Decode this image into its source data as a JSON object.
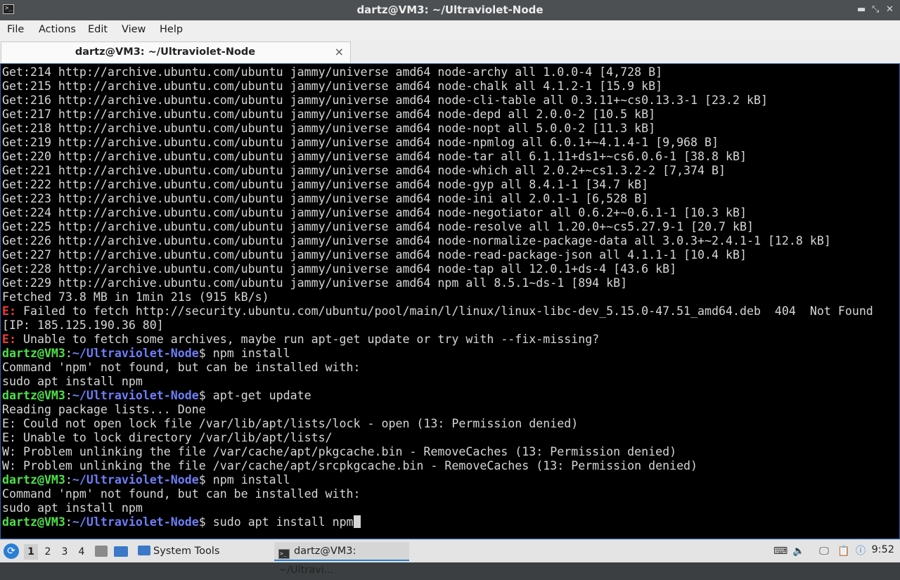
{
  "window": {
    "title": "dartz@VM3: ~/Ultraviolet-Node",
    "controls": {
      "minimize": "▬",
      "maximize": "⤡",
      "close": "✕"
    }
  },
  "menubar": {
    "items": [
      "File",
      "Actions",
      "Edit",
      "View",
      "Help"
    ]
  },
  "tabs": [
    {
      "label": "dartz@VM3: ~/Ultraviolet-Node",
      "close_glyph": "×"
    }
  ],
  "terminal": {
    "colors": {
      "background": "#000000",
      "text": "#d6d6d6",
      "error": "#ef3a3a",
      "user": "#4fe04a",
      "path": "#6e7ef8"
    },
    "prompt": {
      "user": "dartz@VM3",
      "sep": ":",
      "path": "~/Ultraviolet-Node",
      "symbol": "$"
    },
    "lines": [
      {
        "kind": "text",
        "text": "Get:214 http://archive.ubuntu.com/ubuntu jammy/universe amd64 node-archy all 1.0.0-4 [4,728 B]"
      },
      {
        "kind": "text",
        "text": "Get:215 http://archive.ubuntu.com/ubuntu jammy/universe amd64 node-chalk all 4.1.2-1 [15.9 kB]"
      },
      {
        "kind": "text",
        "text": "Get:216 http://archive.ubuntu.com/ubuntu jammy/universe amd64 node-cli-table all 0.3.11+~cs0.13.3-1 [23.2 kB]"
      },
      {
        "kind": "text",
        "text": "Get:217 http://archive.ubuntu.com/ubuntu jammy/universe amd64 node-depd all 2.0.0-2 [10.5 kB]"
      },
      {
        "kind": "text",
        "text": "Get:218 http://archive.ubuntu.com/ubuntu jammy/universe amd64 node-nopt all 5.0.0-2 [11.3 kB]"
      },
      {
        "kind": "text",
        "text": "Get:219 http://archive.ubuntu.com/ubuntu jammy/universe amd64 node-npmlog all 6.0.1+~4.1.4-1 [9,968 B]"
      },
      {
        "kind": "text",
        "text": "Get:220 http://archive.ubuntu.com/ubuntu jammy/universe amd64 node-tar all 6.1.11+ds1+~cs6.0.6-1 [38.8 kB]"
      },
      {
        "kind": "text",
        "text": "Get:221 http://archive.ubuntu.com/ubuntu jammy/universe amd64 node-which all 2.0.2+~cs1.3.2-2 [7,374 B]"
      },
      {
        "kind": "text",
        "text": "Get:222 http://archive.ubuntu.com/ubuntu jammy/universe amd64 node-gyp all 8.4.1-1 [34.7 kB]"
      },
      {
        "kind": "text",
        "text": "Get:223 http://archive.ubuntu.com/ubuntu jammy/universe amd64 node-ini all 2.0.1-1 [6,528 B]"
      },
      {
        "kind": "text",
        "text": "Get:224 http://archive.ubuntu.com/ubuntu jammy/universe amd64 node-negotiator all 0.6.2+~0.6.1-1 [10.3 kB]"
      },
      {
        "kind": "text",
        "text": "Get:225 http://archive.ubuntu.com/ubuntu jammy/universe amd64 node-resolve all 1.20.0+~cs5.27.9-1 [20.7 kB]"
      },
      {
        "kind": "text",
        "text": "Get:226 http://archive.ubuntu.com/ubuntu jammy/universe amd64 node-normalize-package-data all 3.0.3+~2.4.1-1 [12.8 kB]"
      },
      {
        "kind": "text",
        "text": "Get:227 http://archive.ubuntu.com/ubuntu jammy/universe amd64 node-read-package-json all 4.1.1-1 [10.4 kB]"
      },
      {
        "kind": "text",
        "text": "Get:228 http://archive.ubuntu.com/ubuntu jammy/universe amd64 node-tap all 12.0.1+ds-4 [43.6 kB]"
      },
      {
        "kind": "text",
        "text": "Get:229 http://archive.ubuntu.com/ubuntu jammy/universe amd64 npm all 8.5.1~ds-1 [894 kB]"
      },
      {
        "kind": "text",
        "text": "Fetched 73.8 MB in 1min 21s (915 kB/s)"
      },
      {
        "kind": "error",
        "prefix": "E:",
        "text": " Failed to fetch http://security.ubuntu.com/ubuntu/pool/main/l/linux/linux-libc-dev_5.15.0-47.51_amd64.deb  404  Not Found"
      },
      {
        "kind": "text",
        "text": "[IP: 185.125.190.36 80]"
      },
      {
        "kind": "error",
        "prefix": "E:",
        "text": " Unable to fetch some archives, maybe run apt-get update or try with --fix-missing?"
      },
      {
        "kind": "prompt",
        "cmd": " npm install"
      },
      {
        "kind": "text",
        "text": "Command 'npm' not found, but can be installed with:"
      },
      {
        "kind": "text",
        "text": "sudo apt install npm"
      },
      {
        "kind": "prompt",
        "cmd": " apt-get update"
      },
      {
        "kind": "text",
        "text": "Reading package lists... Done"
      },
      {
        "kind": "text",
        "text": "E: Could not open lock file /var/lib/apt/lists/lock - open (13: Permission denied)"
      },
      {
        "kind": "text",
        "text": "E: Unable to lock directory /var/lib/apt/lists/"
      },
      {
        "kind": "text",
        "text": "W: Problem unlinking the file /var/cache/apt/pkgcache.bin - RemoveCaches (13: Permission denied)"
      },
      {
        "kind": "text",
        "text": "W: Problem unlinking the file /var/cache/apt/srcpkgcache.bin - RemoveCaches (13: Permission denied)"
      },
      {
        "kind": "prompt",
        "cmd": " npm install"
      },
      {
        "kind": "text",
        "text": "Command 'npm' not found, but can be installed with:"
      },
      {
        "kind": "text",
        "text": "sudo apt install npm"
      },
      {
        "kind": "prompt",
        "cmd": " sudo apt install npm",
        "cursor": true
      }
    ]
  },
  "taskbar": {
    "start_icon": "start-menu-icon",
    "workspaces": [
      "1",
      "2",
      "3",
      "4"
    ],
    "active_workspace": "1",
    "system_tools_label": "System Tools",
    "terminal_task_label": "dartz@VM3: ~/Ultravi...",
    "tray_icons": [
      "keyboard-icon",
      "volume-icon",
      "network-icon",
      "clipboard-icon",
      "update-notifier-icon",
      "search-icon"
    ],
    "clock": "9:52"
  }
}
